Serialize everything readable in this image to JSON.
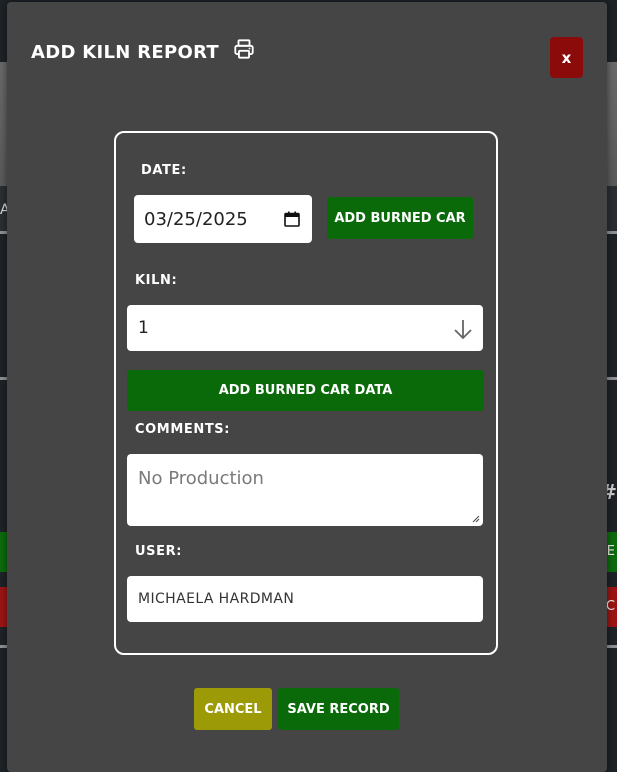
{
  "background": {
    "hash_glyph": "#",
    "left_peek": "Al",
    "right_peek_green": "E",
    "right_peek_red": "C"
  },
  "modal": {
    "title": "ADD KILN REPORT",
    "close_label": "x"
  },
  "form": {
    "date_label": "DATE:",
    "date_value": "03/25/2025",
    "add_burned_car_label": "ADD BURNED CAR",
    "kiln_label": "KILN:",
    "kiln_value": "1",
    "add_burned_car_data_label": "ADD BURNED CAR DATA",
    "comments_label": "COMMENTS:",
    "comments_placeholder": "No Production",
    "user_label": "USER:",
    "user_value": "MICHAELA HARDMAN"
  },
  "actions": {
    "cancel_label": "CANCEL",
    "save_label": "SAVE RECORD"
  },
  "colors": {
    "modal_bg": "#454545",
    "green": "#0a6a0a",
    "red": "#8b0b0b",
    "olive": "#9c9a06"
  }
}
